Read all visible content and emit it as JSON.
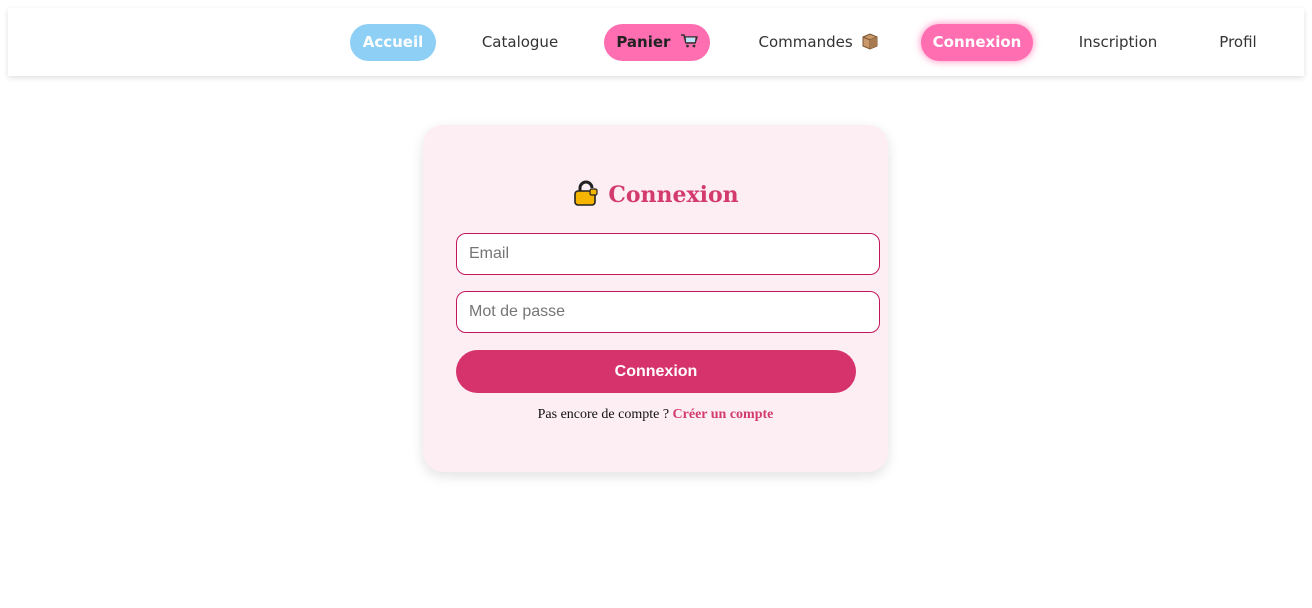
{
  "nav": {
    "items": [
      {
        "label": "Accueil"
      },
      {
        "label": "Catalogue"
      },
      {
        "label": "Panier"
      },
      {
        "label": "Commandes"
      },
      {
        "label": "Connexion"
      },
      {
        "label": "Inscription"
      },
      {
        "label": "Profil"
      }
    ],
    "colors": {
      "accueil_bg": "#8ecff6",
      "pink": "#ff6eb1"
    },
    "icons": {
      "panier": "shopping-cart-icon",
      "commandes": "package-icon"
    }
  },
  "login": {
    "title": "Connexion",
    "title_icon": "lock-icon",
    "email_placeholder": "Email",
    "password_placeholder": "Mot de passe",
    "submit_label": "Connexion",
    "signup_prompt": "Pas encore de compte ?",
    "signup_link": "Créer un compte",
    "colors": {
      "card_bg": "#fdeef4",
      "accent": "#d6336c"
    }
  }
}
